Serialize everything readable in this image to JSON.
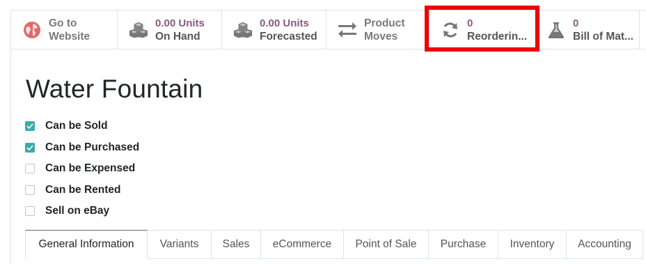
{
  "stat_buttons": [
    {
      "value": "",
      "label_line1": "Go to",
      "label_line2": "Website",
      "icon": "globe-icon"
    },
    {
      "value": "0.00 Units",
      "label": "On Hand",
      "icon": "cubes-icon"
    },
    {
      "value": "0.00 Units",
      "label": "Forecasted",
      "icon": "cubes-icon"
    },
    {
      "value": "",
      "label_line1": "Product",
      "label_line2": "Moves",
      "icon": "exchange-arrows-icon"
    },
    {
      "value": "0",
      "label": "Reorderin...",
      "icon": "refresh-icon"
    },
    {
      "value": "0",
      "label": "Bill of Mat...",
      "icon": "flask-icon"
    }
  ],
  "product": {
    "name": "Water Fountain"
  },
  "checkboxes": [
    {
      "label": "Can be Sold",
      "checked": true
    },
    {
      "label": "Can be Purchased",
      "checked": true
    },
    {
      "label": "Can be Expensed",
      "checked": false
    },
    {
      "label": "Can be Rented",
      "checked": false
    },
    {
      "label": "Sell on eBay",
      "checked": false
    }
  ],
  "tabs": [
    {
      "label": "General Information",
      "active": true
    },
    {
      "label": "Variants",
      "active": false
    },
    {
      "label": "Sales",
      "active": false
    },
    {
      "label": "eCommerce",
      "active": false
    },
    {
      "label": "Point of Sale",
      "active": false
    },
    {
      "label": "Purchase",
      "active": false
    },
    {
      "label": "Inventory",
      "active": false
    },
    {
      "label": "Accounting",
      "active": false
    }
  ],
  "colors": {
    "accent": "#875a7b",
    "check": "#3aadaa",
    "highlight": "#ee0000",
    "globe": "#e06a6a"
  }
}
